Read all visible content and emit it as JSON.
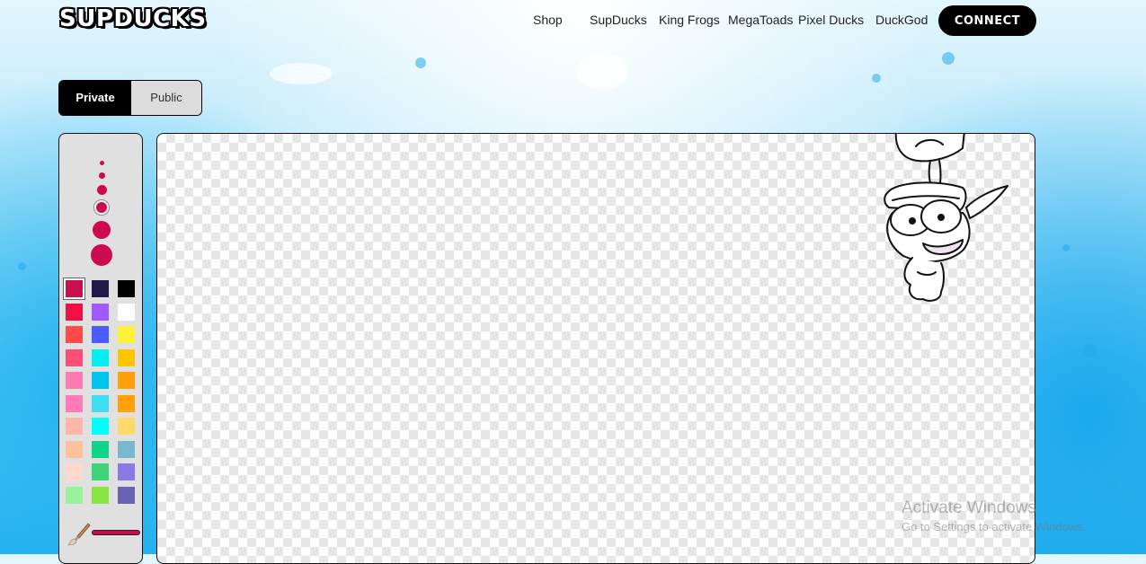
{
  "header": {
    "logo": "SUPDUCKS",
    "nav": [
      "Shop",
      "SupDucks",
      "King Frogs",
      "MegaToads",
      "Pixel Ducks",
      "DuckGod"
    ],
    "connect_label": "CONNECT"
  },
  "visibility_toggle": {
    "options": [
      "Private",
      "Public"
    ],
    "selected": "Private"
  },
  "tools": {
    "brush_sizes": [
      "xs",
      "s",
      "m",
      "l",
      "xl",
      "xxl"
    ],
    "selected_brush_size": "l",
    "palette": [
      [
        "#c8104e",
        "#201a4a",
        "#000000"
      ],
      [
        "#f01048",
        "#a259ff",
        "#ffffff"
      ],
      [
        "#ff4a4a",
        "#4a5bff",
        "#fff23a"
      ],
      [
        "#ff4d7a",
        "#00f0f0",
        "#ffc400"
      ],
      [
        "#ff7ab3",
        "#00c4f0",
        "#ff9f0a"
      ],
      [
        "#ff7ab6",
        "#3fdcf5",
        "#ffa20a"
      ],
      [
        "#fdb6a9",
        "#00ffff",
        "#ffda6a"
      ],
      [
        "#ffc19c",
        "#0fd48a",
        "#7bb7cf"
      ],
      [
        "#ffd8d0",
        "#40d47a",
        "#8b7ae6"
      ],
      [
        "#9af29a",
        "#8ae640",
        "#6863b5"
      ]
    ],
    "selected_color": "#c8104e",
    "brush_icon": "paintbrush-icon"
  },
  "canvas": {
    "background": "transparent-checkerboard",
    "sticker": "duck-character"
  },
  "os_overlay": {
    "activate_title": "Activate Windows",
    "activate_subtitle": "Go to Settings to activate Windows."
  }
}
